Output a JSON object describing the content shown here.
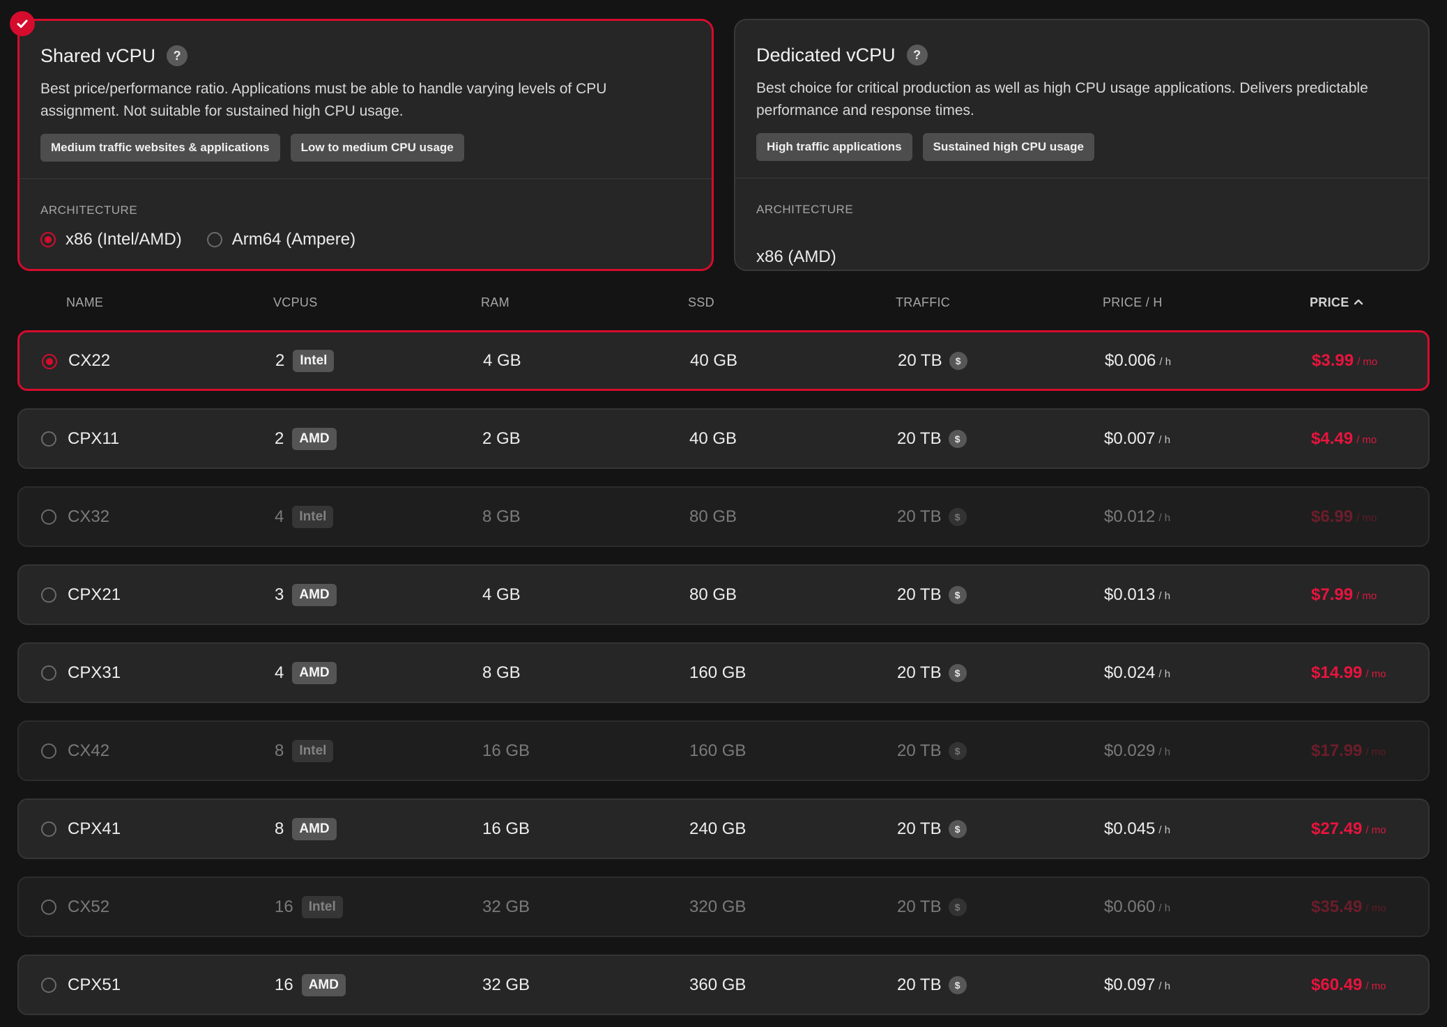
{
  "cards": {
    "shared": {
      "title": "Shared vCPU",
      "help": "?",
      "description": "Best price/performance ratio. Applications must be able to handle varying levels of CPU assignment. Not suitable for sustained high CPU usage.",
      "chips": [
        "Medium traffic websites & applications",
        "Low to medium CPU usage"
      ],
      "arch_label": "ARCHITECTURE",
      "arch_options": [
        "x86 (Intel/AMD)",
        "Arm64 (Ampere)"
      ],
      "arch_selected": "x86 (Intel/AMD)",
      "selected": true
    },
    "dedicated": {
      "title": "Dedicated vCPU",
      "help": "?",
      "description": "Best choice for critical production as well as high CPU usage applications. Delivers predictable performance and response times.",
      "chips": [
        "High traffic applications",
        "Sustained high CPU usage"
      ],
      "arch_label": "ARCHITECTURE",
      "arch_value": "x86 (AMD)",
      "selected": false
    }
  },
  "table": {
    "headers": {
      "name": "NAME",
      "vcpus": "VCPUS",
      "ram": "RAM",
      "ssd": "SSD",
      "traffic": "TRAFFIC",
      "price_h": "PRICE / H",
      "price": "PRICE"
    },
    "sort": {
      "column": "price",
      "direction": "ascending"
    },
    "units": {
      "hour": "/ h",
      "month": "/ mo",
      "dollar_icon": "$"
    },
    "accent_color": "#d50c2d",
    "rows": [
      {
        "name": "CX22",
        "vcpus": "2",
        "cpu": "Intel",
        "ram": "4 GB",
        "ssd": "40 GB",
        "traffic": "20 TB",
        "price_h": "$0.006",
        "price": "$3.99",
        "selected": true,
        "available": true
      },
      {
        "name": "CPX11",
        "vcpus": "2",
        "cpu": "AMD",
        "ram": "2 GB",
        "ssd": "40 GB",
        "traffic": "20 TB",
        "price_h": "$0.007",
        "price": "$4.49",
        "selected": false,
        "available": true
      },
      {
        "name": "CX32",
        "vcpus": "4",
        "cpu": "Intel",
        "ram": "8 GB",
        "ssd": "80 GB",
        "traffic": "20 TB",
        "price_h": "$0.012",
        "price": "$6.99",
        "selected": false,
        "available": false
      },
      {
        "name": "CPX21",
        "vcpus": "3",
        "cpu": "AMD",
        "ram": "4 GB",
        "ssd": "80 GB",
        "traffic": "20 TB",
        "price_h": "$0.013",
        "price": "$7.99",
        "selected": false,
        "available": true
      },
      {
        "name": "CPX31",
        "vcpus": "4",
        "cpu": "AMD",
        "ram": "8 GB",
        "ssd": "160 GB",
        "traffic": "20 TB",
        "price_h": "$0.024",
        "price": "$14.99",
        "selected": false,
        "available": true
      },
      {
        "name": "CX42",
        "vcpus": "8",
        "cpu": "Intel",
        "ram": "16 GB",
        "ssd": "160 GB",
        "traffic": "20 TB",
        "price_h": "$0.029",
        "price": "$17.99",
        "selected": false,
        "available": false
      },
      {
        "name": "CPX41",
        "vcpus": "8",
        "cpu": "AMD",
        "ram": "16 GB",
        "ssd": "240 GB",
        "traffic": "20 TB",
        "price_h": "$0.045",
        "price": "$27.49",
        "selected": false,
        "available": true
      },
      {
        "name": "CX52",
        "vcpus": "16",
        "cpu": "Intel",
        "ram": "32 GB",
        "ssd": "320 GB",
        "traffic": "20 TB",
        "price_h": "$0.060",
        "price": "$35.49",
        "selected": false,
        "available": false
      },
      {
        "name": "CPX51",
        "vcpus": "16",
        "cpu": "AMD",
        "ram": "32 GB",
        "ssd": "360 GB",
        "traffic": "20 TB",
        "price_h": "$0.097",
        "price": "$60.49",
        "selected": false,
        "available": true
      }
    ]
  }
}
